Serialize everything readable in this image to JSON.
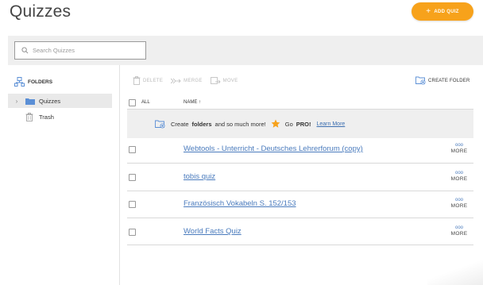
{
  "header": {
    "title": "Quizzes",
    "add_button": "ADD QUIZ",
    "add_symbol": "+"
  },
  "search": {
    "placeholder": "Search Quizzes"
  },
  "sidebar": {
    "heading": "FOLDERS",
    "items": [
      {
        "label": "Quizzes",
        "active": true
      },
      {
        "label": "Trash",
        "active": false
      }
    ]
  },
  "toolbar": {
    "delete": "DELETE",
    "merge": "MERGE",
    "move": "MOVE",
    "create_folder": "CREATE FOLDER"
  },
  "table": {
    "all_label": "ALL",
    "name_header": "NAME ↑"
  },
  "promo": {
    "text_before": "Create",
    "text_bold": "folders",
    "text_after": "and so much more!",
    "go_pro_prefix": "Go",
    "go_pro_bold": "PRO!",
    "learn_more": "Learn More"
  },
  "quizzes": [
    {
      "name": "Webtools - Unterricht - Deutsches Lehrerforum (copy)"
    },
    {
      "name": "tobis quiz"
    },
    {
      "name": "Französisch Vokabeln S. 152/153"
    },
    {
      "name": "World Facts Quiz"
    }
  ],
  "row_action": {
    "dots": "ooo",
    "label": "MORE"
  },
  "colors": {
    "accent_orange": "#f7a21b",
    "link_blue": "#4a7bbd",
    "folder_blue": "#5b8fd6",
    "star": "#f7a21b"
  }
}
